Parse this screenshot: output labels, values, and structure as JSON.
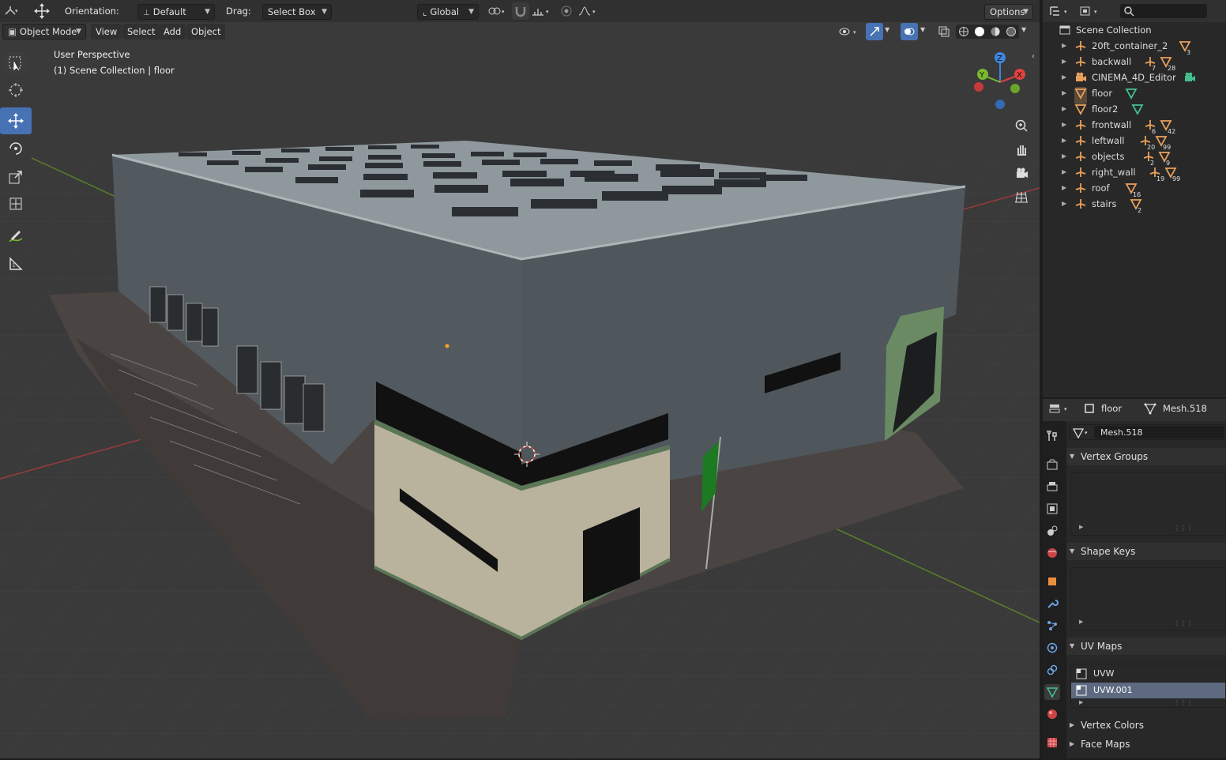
{
  "header": {
    "orientation_label": "Orientation:",
    "orientation_value": "Default",
    "drag_label": "Drag:",
    "drag_value": "Select Box",
    "transform_space": "Global",
    "options_label": "Options"
  },
  "viewport_header": {
    "mode": "Object Mode",
    "menus": [
      "View",
      "Select",
      "Add",
      "Object"
    ]
  },
  "viewport": {
    "perspective_label": "User Perspective",
    "collection_label": "(1) Scene Collection | floor",
    "gizmo_axes": {
      "x": "X",
      "y": "Y",
      "z": "Z"
    }
  },
  "outliner": {
    "root": "Scene Collection",
    "items": [
      {
        "name": "20ft_container_2",
        "icon": "empty-icon",
        "extras": [
          {
            "icon": "mesh-icon",
            "count": "3"
          }
        ]
      },
      {
        "name": "backwall",
        "icon": "empty-icon",
        "extras": [
          {
            "icon": "empty-icon",
            "count": "7"
          },
          {
            "icon": "mesh-icon",
            "count": "28"
          }
        ]
      },
      {
        "name": "CINEMA_4D_Editor",
        "icon": "camera-icon",
        "extras": [
          {
            "icon": "camera-data-icon",
            "count": ""
          }
        ]
      },
      {
        "name": "floor",
        "icon": "mesh-icon",
        "extras": [
          {
            "icon": "mesh-data-icon",
            "count": ""
          }
        ]
      },
      {
        "name": "floor2",
        "icon": "mesh-icon",
        "extras": [
          {
            "icon": "mesh-data-icon",
            "count": ""
          }
        ]
      },
      {
        "name": "frontwall",
        "icon": "empty-icon",
        "extras": [
          {
            "icon": "empty-icon",
            "count": "6"
          },
          {
            "icon": "mesh-icon",
            "count": "42"
          }
        ]
      },
      {
        "name": "leftwall",
        "icon": "empty-icon",
        "extras": [
          {
            "icon": "empty-icon",
            "count": "20"
          },
          {
            "icon": "mesh-icon",
            "count": "99"
          }
        ]
      },
      {
        "name": "objects",
        "icon": "empty-icon",
        "extras": [
          {
            "icon": "empty-icon",
            "count": "2"
          },
          {
            "icon": "mesh-icon",
            "count": "9"
          }
        ]
      },
      {
        "name": "right_wall",
        "icon": "empty-icon",
        "extras": [
          {
            "icon": "empty-icon",
            "count": "19"
          },
          {
            "icon": "mesh-icon",
            "count": "99"
          }
        ]
      },
      {
        "name": "roof",
        "icon": "empty-icon",
        "extras": [
          {
            "icon": "mesh-icon",
            "count": "16"
          }
        ]
      },
      {
        "name": "stairs",
        "icon": "empty-icon",
        "extras": [
          {
            "icon": "mesh-icon",
            "count": "2"
          }
        ]
      }
    ]
  },
  "properties": {
    "breadcrumb_object": "floor",
    "breadcrumb_mesh": "Mesh.518",
    "datablock": "Mesh.518",
    "sections": {
      "vertex_groups": "Vertex Groups",
      "shape_keys": "Shape Keys",
      "uv_maps": "UV Maps",
      "vertex_colors": "Vertex Colors",
      "face_maps": "Face Maps"
    },
    "uv_maps": [
      "UVW",
      "UVW.001"
    ]
  },
  "colors": {
    "accent_blue": "#4772b3",
    "object_orange": "#e8a05c",
    "mesh_green": "#44c190",
    "axis_x": "#e2413f",
    "axis_y": "#7bbb2f",
    "axis_z": "#3d86e0"
  }
}
